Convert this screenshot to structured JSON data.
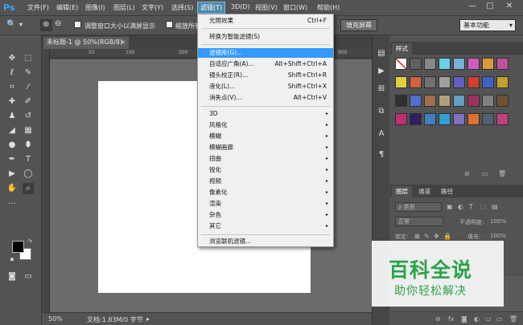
{
  "app": {
    "logo": "Ps"
  },
  "menubar": {
    "items": [
      "文件(F)",
      "编辑(E)",
      "图像(I)",
      "图层(L)",
      "文字(Y)",
      "选择(S)",
      "滤镜(T)",
      "3D(D)",
      "视图(V)",
      "窗口(W)",
      "帮助(H)"
    ],
    "active_index": 6
  },
  "window_controls": {
    "minimize": "—",
    "restore": "□",
    "close": "✕"
  },
  "options": {
    "zoom_icon": "🔍",
    "zoom_in": "⊕",
    "zoom_out": "⊖",
    "resize_windows_label": "调整窗口大小以满屏显示",
    "zoom_all_label": "缩放所有",
    "fill_screen_label": "填充屏幕",
    "workspace_value": "基本功能"
  },
  "document": {
    "tab_title": "未标题-1 @ 50%(RGB/8)",
    "tab_close": "×",
    "ruler_h": [
      "50",
      "100",
      "200",
      "900"
    ],
    "zoom_value": "50%",
    "doc_info": "文档:1.83M/0 字节"
  },
  "filter_menu": {
    "items": [
      {
        "label": "光照效果",
        "shortcut": "Ctrl+F"
      },
      {
        "label": "转换为智能滤镜(S)"
      },
      {
        "label": "滤镜库(G)...",
        "highlighted": true
      },
      {
        "label": "自适应广角(A)...",
        "shortcut": "Alt+Shift+Ctrl+A"
      },
      {
        "label": "镜头校正(R)...",
        "shortcut": "Shift+Ctrl+R"
      },
      {
        "label": "液化(L)...",
        "shortcut": "Shift+Ctrl+X"
      },
      {
        "label": "消失点(V)...",
        "shortcut": "Alt+Ctrl+V"
      },
      {
        "label": "3D",
        "submenu": true
      },
      {
        "label": "风格化",
        "submenu": true
      },
      {
        "label": "模糊",
        "submenu": true
      },
      {
        "label": "模糊画廊",
        "submenu": true
      },
      {
        "label": "扭曲",
        "submenu": true
      },
      {
        "label": "锐化",
        "submenu": true
      },
      {
        "label": "视频",
        "submenu": true
      },
      {
        "label": "像素化",
        "submenu": true
      },
      {
        "label": "渲染",
        "submenu": true
      },
      {
        "label": "杂色",
        "submenu": true
      },
      {
        "label": "其它",
        "submenu": true
      },
      {
        "label": "浏览联机滤镜..."
      }
    ],
    "submenu_arrow": "▸"
  },
  "styles_panel": {
    "tab": "样式",
    "colors": [
      "#ffffff",
      "#606060",
      "#888888",
      "#6ad0e6",
      "#7ab0d8",
      "#d05cc0",
      "#dd9a3a",
      "#c050a0",
      "#e0d040",
      "#d06040",
      "#707070",
      "#a0a0a0",
      "#6060c0",
      "#d04030",
      "#4060c0",
      "#c0a030",
      "#303030",
      "#5070d0",
      "#a07050",
      "#b0a080",
      "#60a0c0",
      "#a03060",
      "#808080",
      "#705030",
      "#c03070",
      "#302060",
      "#4080c0",
      "#30a0d0",
      "#8070c0",
      "#e07030",
      "#506070",
      "#c04080"
    ],
    "footer_icons": [
      "⊘",
      "▭",
      "🗑"
    ]
  },
  "layers_panel": {
    "tabs": [
      "图层",
      "通道",
      "路径"
    ],
    "kind_label": "ρ 类型",
    "blend_mode": "正常",
    "opacity_label": "不透明度:",
    "opacity_value": "100%",
    "lock_label": "锁定:",
    "fill_label": "填充:",
    "fill_value": "100%",
    "footer_icons": [
      "⊖",
      "fx",
      "◙",
      "◐",
      "▭",
      "▭",
      "🗑"
    ]
  },
  "watermark": {
    "title": "百科全说",
    "subtitle": "助你轻松解决"
  }
}
